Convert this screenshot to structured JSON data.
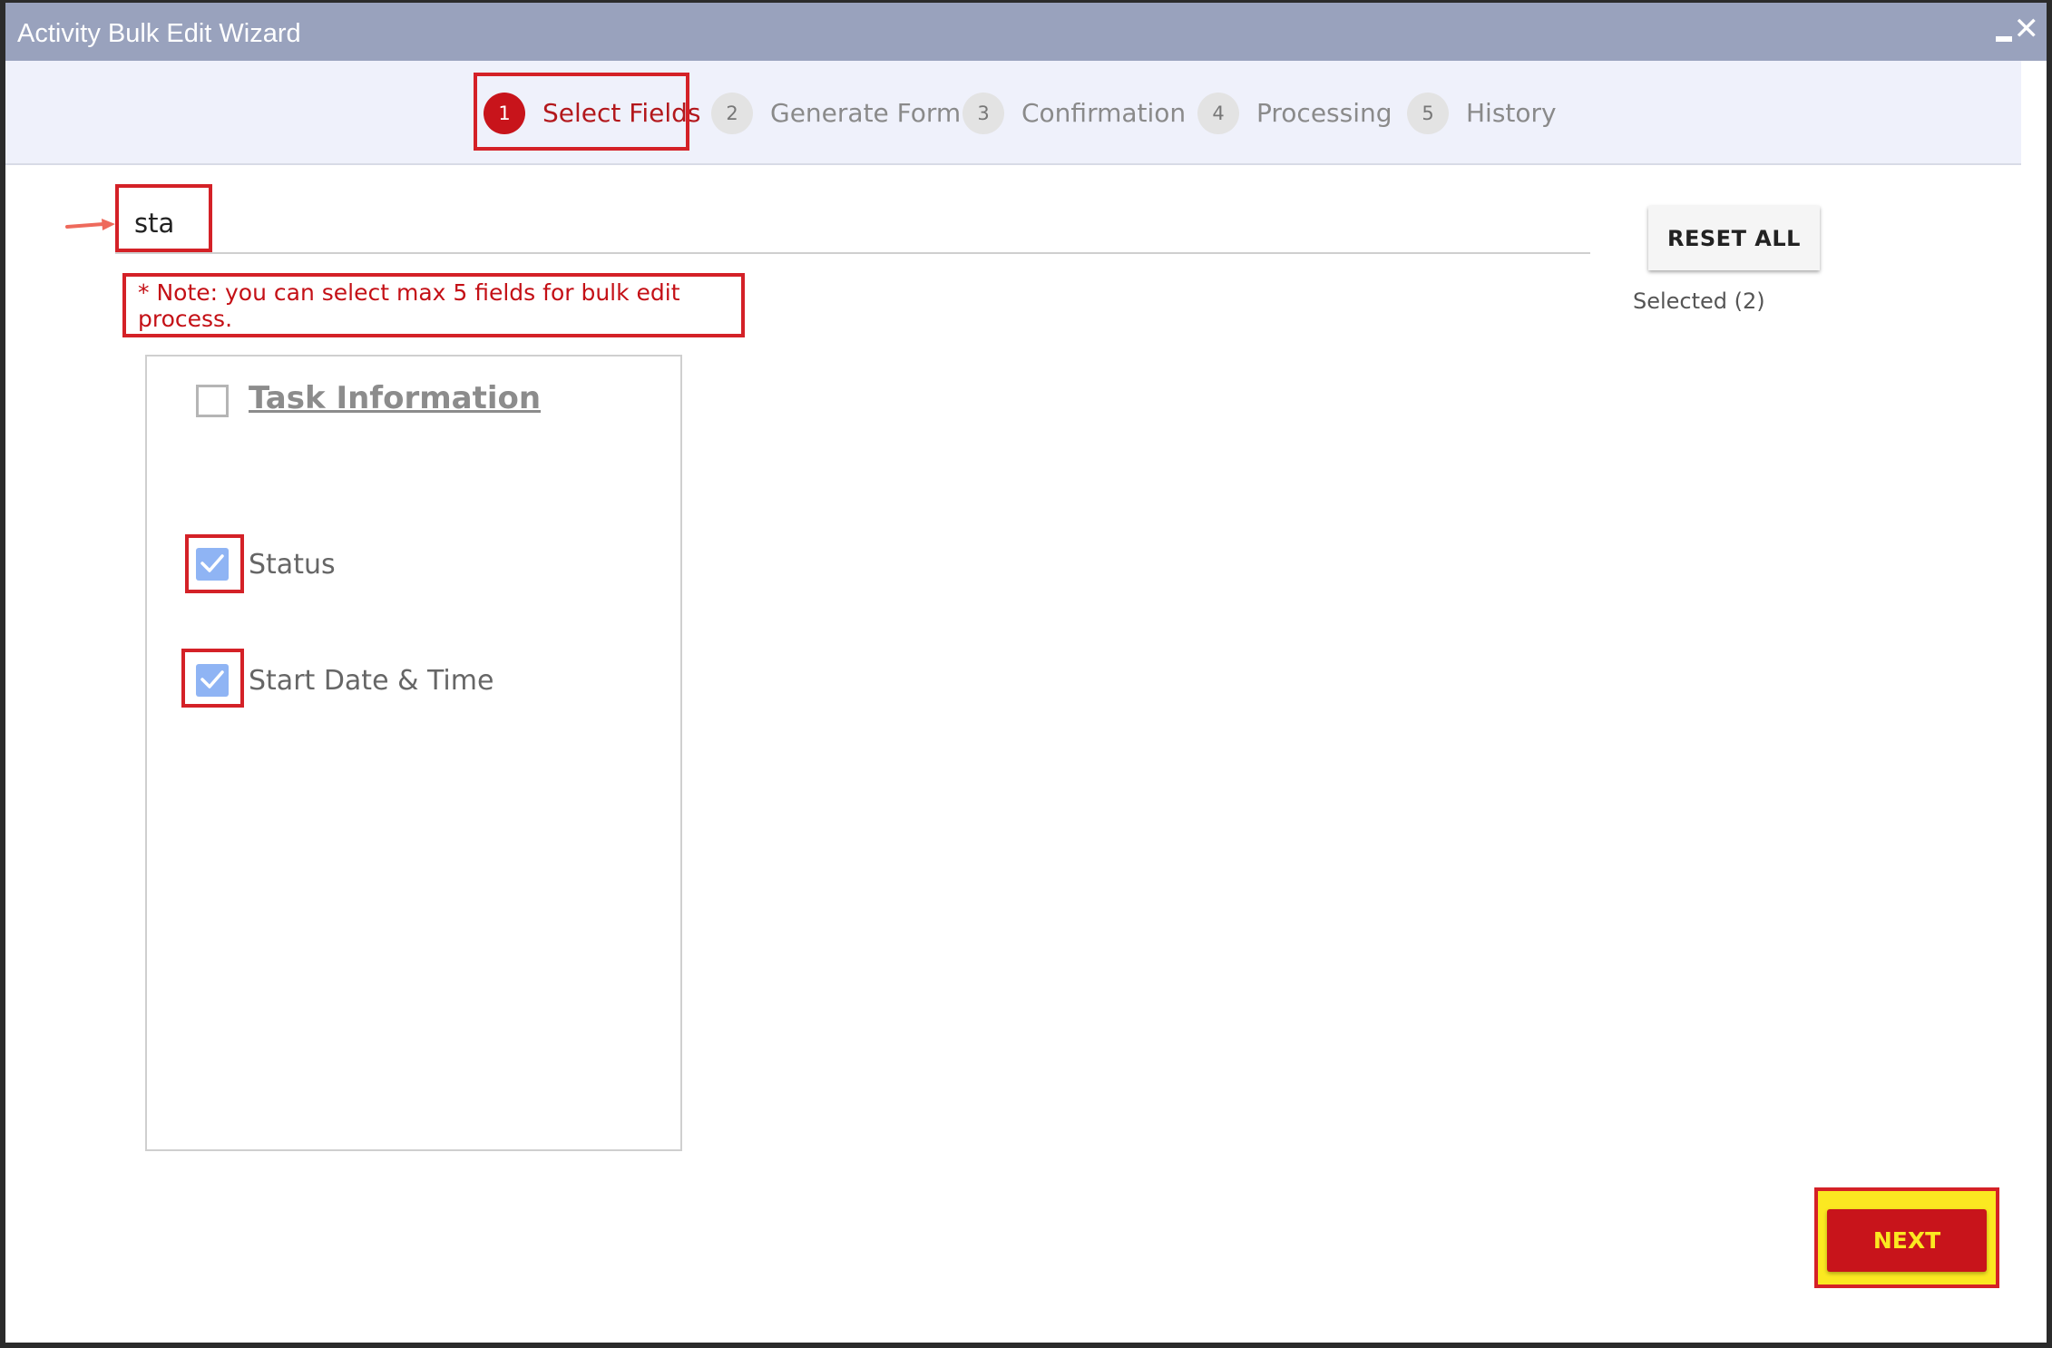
{
  "window": {
    "title": "Activity Bulk Edit Wizard",
    "minimize_icon": "minimize-icon",
    "close_icon": "close-icon"
  },
  "steps": [
    {
      "number": "1",
      "label": "Select Fields",
      "active": true
    },
    {
      "number": "2",
      "label": "Generate Form",
      "active": false
    },
    {
      "number": "3",
      "label": "Confirmation",
      "active": false
    },
    {
      "number": "4",
      "label": "Processing",
      "active": false
    },
    {
      "number": "5",
      "label": "History",
      "active": false
    }
  ],
  "search": {
    "value": "sta",
    "placeholder": ""
  },
  "note": "* Note: you can select max 5 fields for bulk edit process.",
  "reset_label": "RESET ALL",
  "selected_label": "Selected (2)",
  "group": {
    "title": "Task Information",
    "checked": false,
    "fields": [
      {
        "label": "Status",
        "checked": true
      },
      {
        "label": "Start Date & Time",
        "checked": true
      }
    ]
  },
  "next_label": "NEXT",
  "colors": {
    "accent": "#c8141b",
    "titlebar": "#99a2bd",
    "highlight": "#fbe821",
    "checkbox": "#8fb4f4",
    "annotation": "#d42127"
  }
}
